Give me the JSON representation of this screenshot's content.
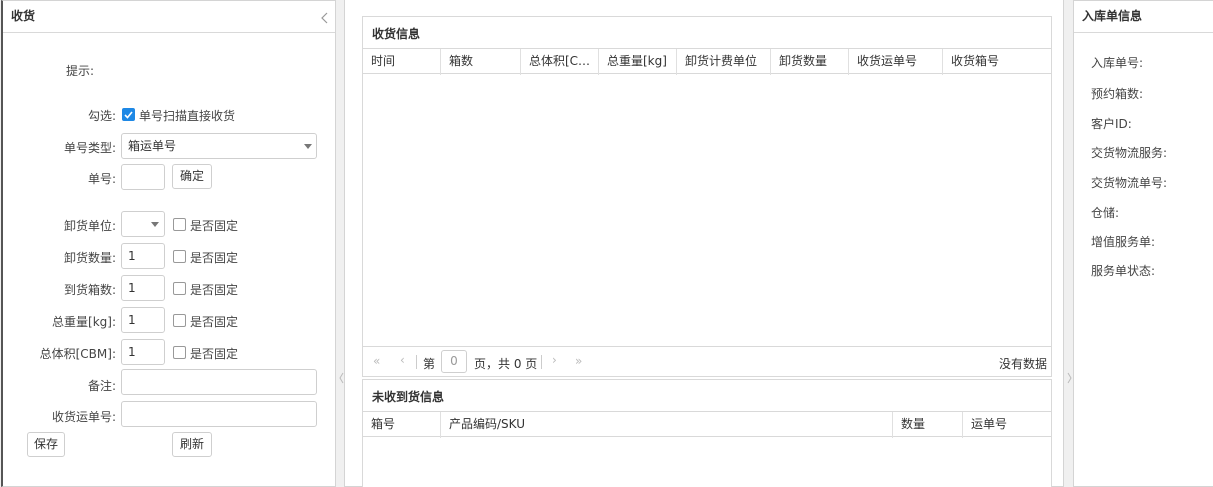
{
  "left": {
    "title": "收货",
    "hint_label": "提示:",
    "check_label": "勾选:",
    "scan_option": "单号扫描直接收货",
    "order_type_label": "单号类型:",
    "order_type_value": "箱运单号",
    "order_no_label": "单号:",
    "order_no_value": "",
    "confirm_button": "确定",
    "fixed_label": "是否固定",
    "unload_unit_label": "卸货单位:",
    "unload_qty_label": "卸货数量:",
    "unload_qty_value": "1",
    "arrive_boxes_label": "到货箱数:",
    "arrive_boxes_value": "1",
    "weight_label": "总重量[kg]:",
    "weight_value": "1",
    "volume_label": "总体积[CBM]:",
    "volume_value": "1",
    "remark_label": "备注:",
    "remark_value": "",
    "waybill_label": "收货运单号:",
    "waybill_value": "",
    "save_button": "保存",
    "refresh_button": "刷新"
  },
  "receipt": {
    "title": "收货信息",
    "columns": [
      "时间",
      "箱数",
      "总体积[C…",
      "总重量[kg]",
      "卸货计费单位",
      "卸货数量",
      "收货运单号",
      "收货箱号"
    ],
    "pager": {
      "page_prefix": "第",
      "page_value": "0",
      "page_suffix": "页，共 0 页",
      "no_data": "没有数据"
    }
  },
  "pending": {
    "title": "未收到货信息",
    "columns": [
      "箱号",
      "产品编码/SKU",
      "数量",
      "运单号"
    ]
  },
  "inbound": {
    "title": "入库单信息",
    "fields": [
      "入库单号:",
      "预约箱数:",
      "客户ID:",
      "交货物流服务:",
      "交货物流单号:",
      "仓储:",
      "增值服务单:",
      "服务单状态:"
    ]
  },
  "colors": {
    "accent": "#1e88e5",
    "border": "#d4d4d4",
    "background": "#f0f0f0"
  }
}
